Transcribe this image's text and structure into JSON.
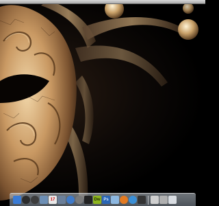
{
  "desktop": {
    "wallpaper": "venetian-mask-wallpaper"
  },
  "dock": {
    "icons": [
      {
        "name": "finder-icon",
        "color": "#3a7bd5"
      },
      {
        "name": "dashboard-icon",
        "color": "#2b2b2b"
      },
      {
        "name": "address-book-icon",
        "color": "#3c3c3c"
      },
      {
        "name": "mail-icon",
        "color": "#6d8fb5"
      },
      {
        "name": "ical-icon",
        "color": "#e8e8e8",
        "label": "17"
      },
      {
        "name": "preview-icon",
        "color": "#6b7f99"
      },
      {
        "name": "itunes-icon",
        "color": "#3f7ac9"
      },
      {
        "name": "system-preferences-icon",
        "color": "#7a7a7a"
      },
      {
        "name": "photo-booth-icon",
        "color": "#222222"
      },
      {
        "name": "dreamweaver-icon",
        "color": "#8db51d",
        "label": "Dw"
      },
      {
        "name": "photoshop-icon",
        "color": "#2a66b5",
        "label": "Ps"
      },
      {
        "name": "network-icon",
        "color": "#8cb7e0"
      },
      {
        "name": "firefox-icon",
        "color": "#e37a21"
      },
      {
        "name": "safari-icon",
        "color": "#3b8fd6"
      },
      {
        "name": "terminal-icon",
        "color": "#333333"
      },
      {
        "name": "documents-stack-icon",
        "color": "#cfcfcf"
      },
      {
        "name": "downloads-stack-icon",
        "color": "#b0b0b0"
      },
      {
        "name": "trash-icon",
        "color": "#d9dde2"
      }
    ]
  }
}
